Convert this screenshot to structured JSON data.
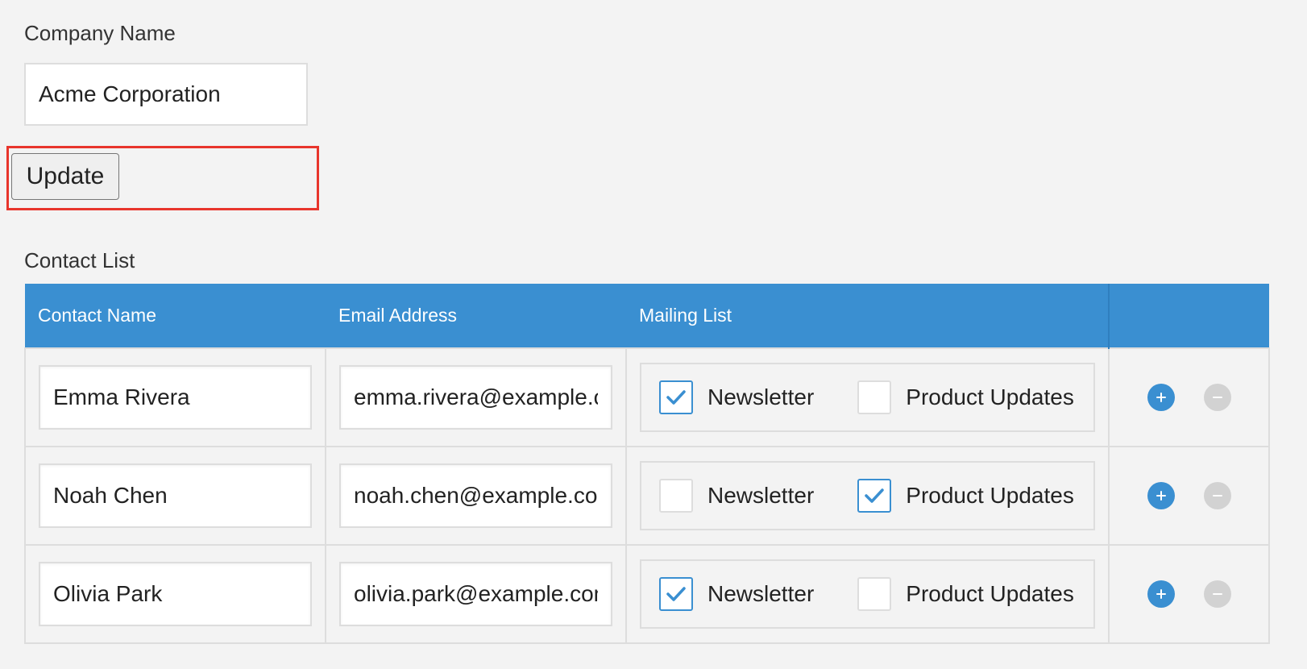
{
  "company": {
    "label": "Company Name",
    "value": "Acme Corporation"
  },
  "update_button": {
    "label": "Update"
  },
  "contacts": {
    "label": "Contact List",
    "columns": {
      "name": "Contact Name",
      "email": "Email Address",
      "mailing": "Mailing List"
    },
    "options": {
      "newsletter": "Newsletter",
      "product_updates": "Product Updates"
    },
    "rows": [
      {
        "name": "Emma Rivera",
        "email": "emma.rivera@example.com",
        "newsletter": true,
        "product_updates": false
      },
      {
        "name": "Noah Chen",
        "email": "noah.chen@example.com",
        "newsletter": false,
        "product_updates": true
      },
      {
        "name": "Olivia Park",
        "email": "olivia.park@example.com",
        "newsletter": true,
        "product_updates": false
      }
    ]
  },
  "icons": {
    "add": "plus-circle-icon",
    "remove": "minus-circle-icon",
    "check": "checkmark-icon"
  },
  "colors": {
    "accent": "#3a8fd1",
    "highlight": "#e8352c",
    "disabled": "#d2d2d2"
  }
}
